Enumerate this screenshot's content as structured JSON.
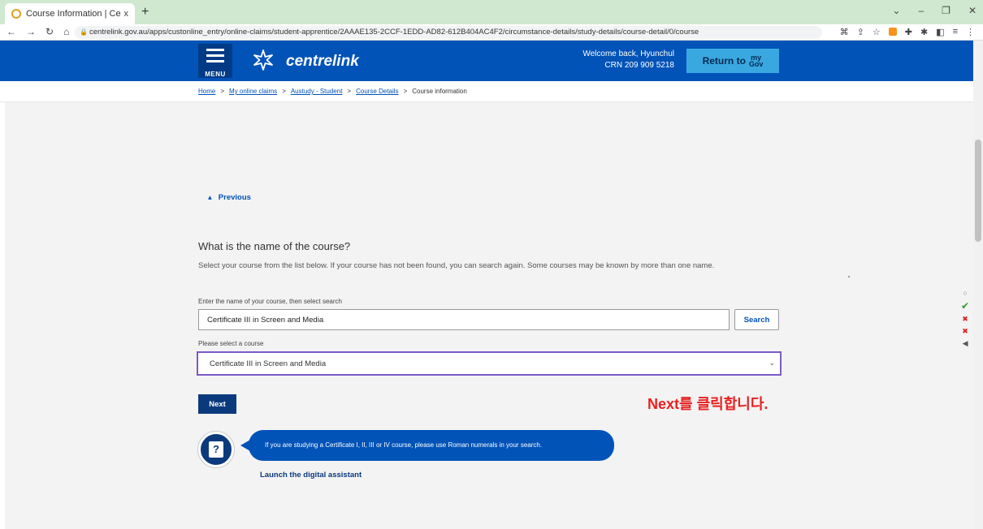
{
  "browser": {
    "tab_title": "Course Information | Centrelink",
    "tab_close": "x",
    "new_tab": "+",
    "url": "centrelink.gov.au/apps/custonline_entry/online-claims/student-apprentice/2AAAE135-2CCF-1EDD-AD82-612B404AC4F2/circumstance-details/study-details/course-detail/0/course"
  },
  "header": {
    "menu_label": "MENU",
    "brand": "centrelink",
    "welcome_line1": "Welcome back, Hyunchul",
    "welcome_line2": "CRN 209 909 5218",
    "return_label": "Return to",
    "mygov_top": "my",
    "mygov_bottom": "Gov"
  },
  "breadcrumb": {
    "items": [
      "Home",
      "My online claims",
      "Austudy - Student",
      "Course Details"
    ],
    "current": "Course information",
    "sep": ">"
  },
  "form": {
    "previous_label": "Previous",
    "question": "What is the name of the course?",
    "hint": "Select your course from the list below. If your course has not been found, you can search again. Some courses may be known by more than one name.",
    "search_label": "Enter the name of your course, then select search",
    "search_value": "Certificate III in Screen and Media",
    "search_button": "Search",
    "select_label": "Please select a course",
    "select_value": "Certificate III in Screen and Media",
    "next_button": "Next"
  },
  "annotation": "Next를 클릭합니다.",
  "assistant": {
    "message": "If you are studying a Certificate I, II, III or IV course, please use Roman numerals in your search.",
    "launch_label": "Launch the digital assistant"
  },
  "colors": {
    "header_blue": "#0153b8",
    "button_navy": "#0b3a7c",
    "focus_purple": "#7d59c7",
    "annotation_red": "#e82020"
  }
}
